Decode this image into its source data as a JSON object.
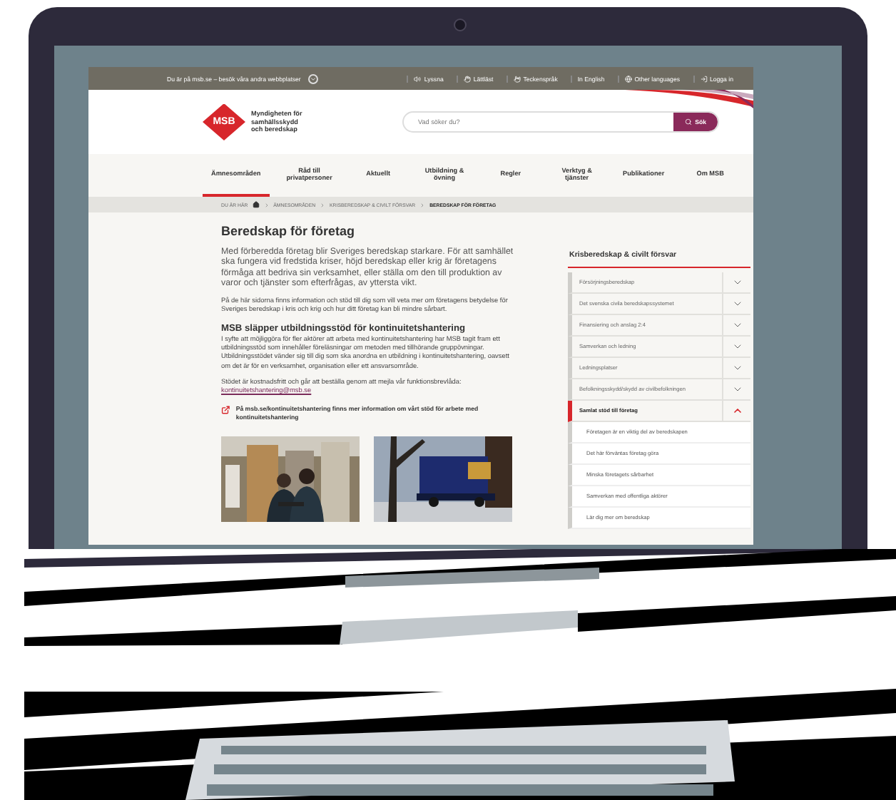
{
  "top_bar": {
    "site_notice": "Du är på msb.se – besök våra andra webbplatser",
    "links": [
      {
        "label": "Lyssna"
      },
      {
        "label": "Lättläst"
      },
      {
        "label": "Teckenspråk"
      },
      {
        "label": "In English"
      },
      {
        "label": "Other languages"
      },
      {
        "label": "Logga in"
      }
    ]
  },
  "header": {
    "logo_mark": "MSB",
    "logo_text": "Myndigheten för samhällsskydd och beredskap",
    "search": {
      "placeholder": "Vad söker du?",
      "button": "Sök"
    }
  },
  "nav": [
    {
      "label": "Ämnesområden",
      "selected": true
    },
    {
      "label": "Råd till privatpersoner",
      "selected": false
    },
    {
      "label": "Aktuellt",
      "selected": false
    },
    {
      "label": "Utbildning & övning",
      "selected": false
    },
    {
      "label": "Regler",
      "selected": false
    },
    {
      "label": "Verktyg & tjänster",
      "selected": false
    },
    {
      "label": "Publikationer",
      "selected": false
    },
    {
      "label": "Om MSB",
      "selected": false
    }
  ],
  "breadcrumb": {
    "label": "DU ÄR HÄR",
    "items": [
      {
        "label": "ÄMNESOMRÅDEN",
        "current": false
      },
      {
        "label": "KRISBEREDSKAP & CIVILT FÖRSVAR",
        "current": false
      },
      {
        "label": "BEREDSKAP FÖR FÖRETAG",
        "current": true
      }
    ]
  },
  "article": {
    "title": "Beredskap för företag",
    "lead": "Med förberedda företag blir Sveriges beredskap starkare. För att samhället ska fungera vid fredstida kriser, höjd beredskap eller krig är företagens förmåga att bedriva sin verksamhet, eller ställa om den till produktion av varor och tjänster som efterfrågas, av yttersta vikt.",
    "intro": "På de här sidorna finns information och stöd till dig som vill veta mer om företagens betydelse för Sveriges beredskap i kris och krig och hur ditt företag kan bli mindre sårbart.",
    "news_heading": "MSB släpper utbildningsstöd för kontinuitetshantering",
    "news_text": "I syfte att möjliggöra för fler aktörer att arbeta med kontinuitetshantering har MSB tagit fram ett utbildningsstöd som innehåller föreläsningar om metoden med tillhörande gruppövningar. Utbildningsstödet vänder sig till dig som ska anordna en utbildning i kontinuitetshantering, oavsett om det är för en verksamhet, organisation eller ett ansvarsområde.",
    "order_text": "Stödet är kostnadsfritt och går att beställa genom att mejla vår funktionsbrevlåda:",
    "order_link": "kontinuitetshantering@msb.se",
    "external_link": "På msb.se/kontinuitetshantering finns mer information om vårt stöd för arbete med kontinuitetshantering"
  },
  "sidebar": {
    "title": "Krisberedskap & civilt försvar",
    "items": [
      {
        "label": "Försörjningsberedskap",
        "expanded": false
      },
      {
        "label": "Det svenska civila beredskapssystemet",
        "expanded": false
      },
      {
        "label": "Finansiering och anslag 2:4",
        "expanded": false
      },
      {
        "label": "Samverkan och ledning",
        "expanded": false
      },
      {
        "label": "Ledningsplatser",
        "expanded": false
      },
      {
        "label": "Befolkningsskydd/skydd av civilbefolkningen",
        "expanded": false
      },
      {
        "label": "Samlat stöd till företag",
        "expanded": true,
        "children": [
          {
            "label": "Företagen är en viktig del av beredskapen"
          },
          {
            "label": "Det här förväntas företag göra"
          },
          {
            "label": "Minska företagets sårbarhet"
          },
          {
            "label": "Samverkan med offentliga aktörer"
          },
          {
            "label": "Lär dig mer om beredskap"
          }
        ]
      }
    ]
  }
}
